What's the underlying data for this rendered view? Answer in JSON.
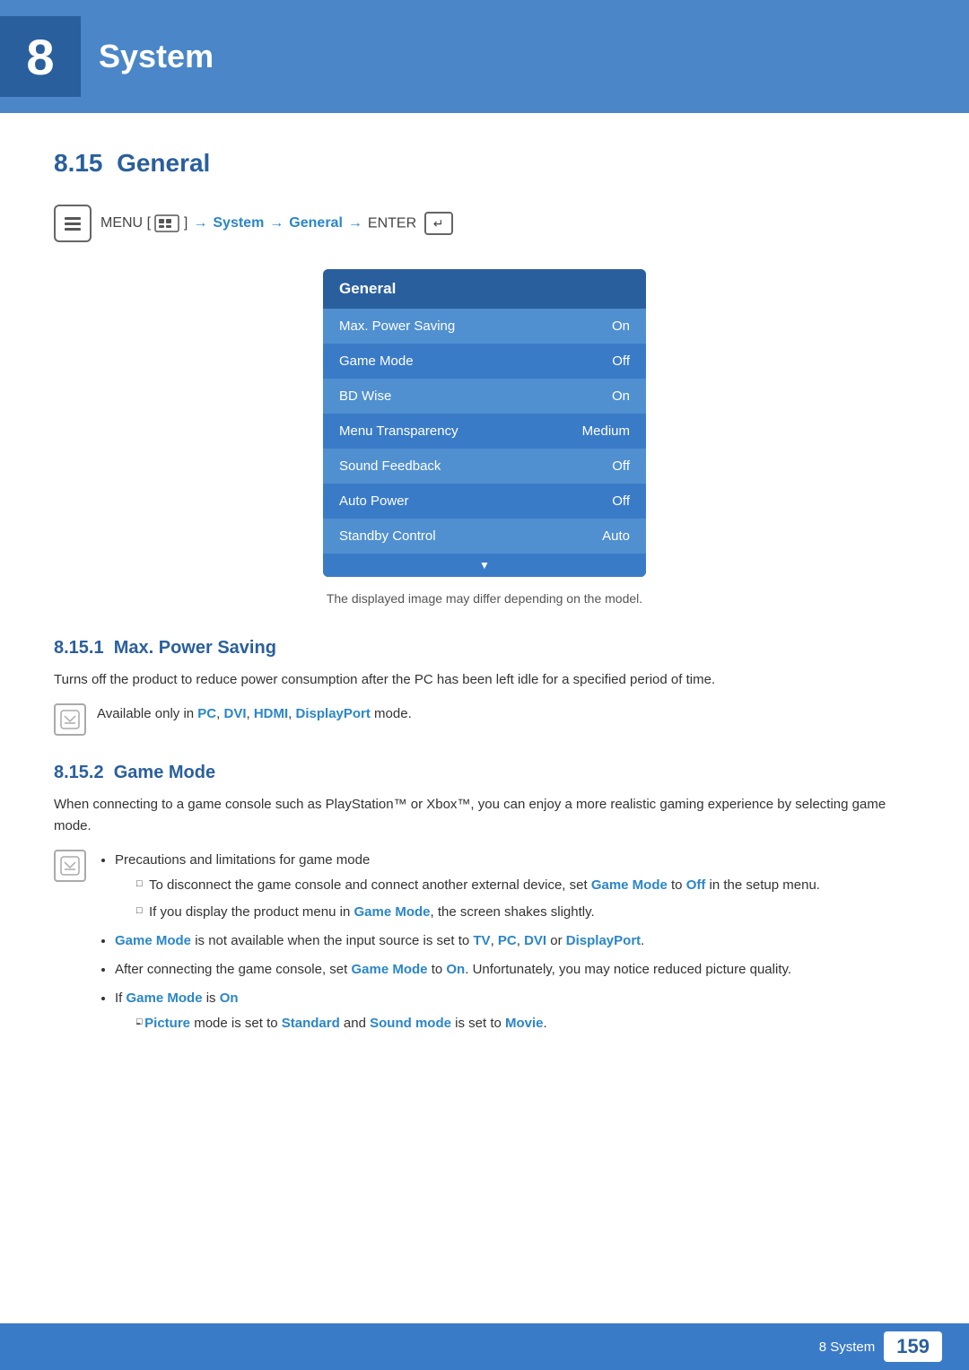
{
  "header": {
    "number": "8",
    "title": "System"
  },
  "section": {
    "id": "8.15",
    "label": "General"
  },
  "nav": {
    "icon_symbol": "🏠",
    "menu_label": "MENU",
    "menu_bracket_open": "[",
    "menu_bracket_close": "]",
    "arrow": "→",
    "system": "System",
    "general": "General",
    "enter_label": "ENTER",
    "enter_symbol": "↵"
  },
  "menu": {
    "title": "General",
    "items": [
      {
        "label": "Max. Power Saving",
        "value": "On"
      },
      {
        "label": "Game Mode",
        "value": "Off"
      },
      {
        "label": "BD Wise",
        "value": "On"
      },
      {
        "label": "Menu Transparency",
        "value": "Medium"
      },
      {
        "label": "Sound Feedback",
        "value": "Off"
      },
      {
        "label": "Auto Power",
        "value": "Off"
      },
      {
        "label": "Standby Control",
        "value": "Auto"
      }
    ]
  },
  "disclaimer": "The displayed image may differ depending on the model.",
  "subsections": [
    {
      "id": "8.15.1",
      "title": "Max. Power Saving",
      "body": "Turns off the product to reduce power consumption after the PC has been left idle for a specified period of time.",
      "note": "Available only in PC, DVI, HDMI, DisplayPort mode.",
      "note_highlights": [
        "PC",
        "DVI",
        "HDMI",
        "DisplayPort"
      ]
    },
    {
      "id": "8.15.2",
      "title": "Game Mode",
      "body": "When connecting to a game console such as PlayStation™ or Xbox™, you can enjoy a more realistic gaming experience by selecting game mode.",
      "bullets": [
        {
          "text": "Precautions and limitations for game mode",
          "subbullets": [
            "To disconnect the game console and connect another external device, set Game Mode to Off in the setup menu.",
            "If you display the product menu in Game Mode, the screen shakes slightly."
          ]
        },
        {
          "text": "Game Mode is not available when the input source is set to TV, PC, DVI or DisplayPort."
        },
        {
          "text": "After connecting the game console, set Game Mode to On. Unfortunately, you may notice reduced picture quality."
        },
        {
          "text": "If Game Mode is On",
          "subbullets": [
            "- Picture mode is set to Standard and Sound mode is set to Movie."
          ]
        }
      ]
    }
  ],
  "footer": {
    "section_label": "8 System",
    "page_number": "159"
  }
}
